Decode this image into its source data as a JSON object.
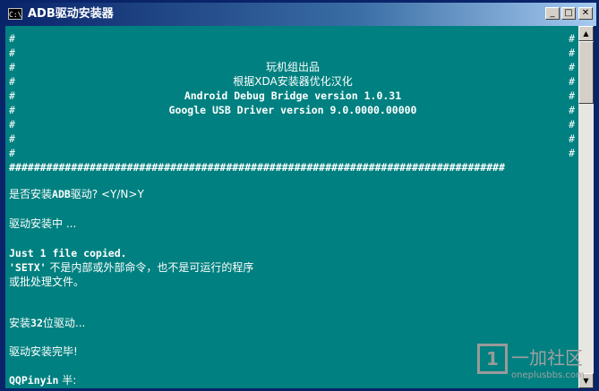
{
  "window": {
    "title": "ADB驱动安装器",
    "icon_label": "C:\\",
    "minimize_symbol": "_",
    "maximize_symbol": "□",
    "close_symbol": "✕"
  },
  "console": {
    "hash": "#",
    "hash_row": "################################################################################",
    "banner": {
      "line1": "玩机组出品",
      "line2": "根据XDA安装器优化汉化",
      "line3": "Android Debug Bridge version 1.0.31",
      "line4": "Google USB Driver version 9.0.0000.00000"
    },
    "prompt_prefix": "是否安装",
    "prompt_bold": "ADB",
    "prompt_suffix": "驱动? <Y/N>Y",
    "installing": "驱动安装中 ...",
    "copied": "Just 1 file copied.",
    "setx_bold": "'SETX'",
    "setx_rest": " 不是内部或外部命令，也不是可运行的程序",
    "batch": "或批处理文件。",
    "install32_prefix": "安装",
    "install32_bold": "32",
    "install32_suffix": "位驱动...",
    "done": "驱动安装完毕!",
    "ime_bold": "QQPinyin",
    "ime_rest": " 半:"
  },
  "scrollbar": {
    "up_symbol": "▲",
    "down_symbol": "▼"
  },
  "watermark": {
    "brand": "一加社区",
    "url": "oneplusbbs.com",
    "icon_glyph": "1"
  }
}
